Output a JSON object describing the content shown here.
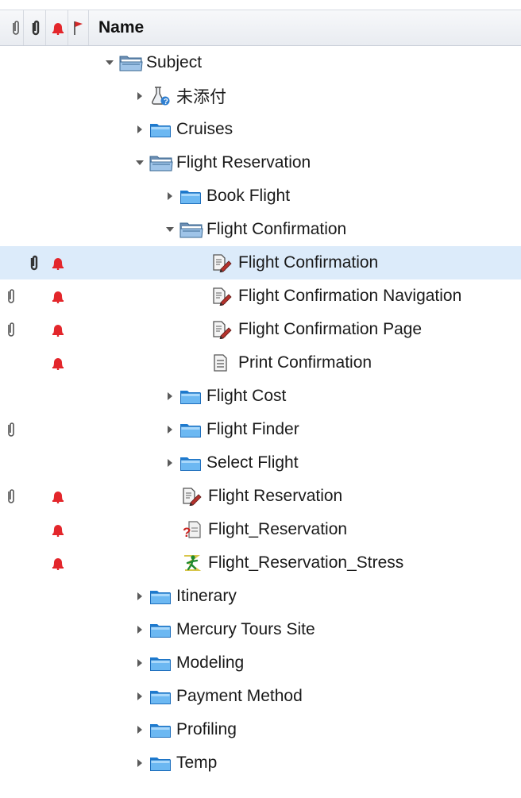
{
  "header": {
    "name_label": "Name",
    "columns": [
      {
        "icon": "attachment-icon"
      },
      {
        "icon": "attachment-icon"
      },
      {
        "icon": "alert-bell-icon"
      },
      {
        "icon": "flag-icon"
      }
    ]
  },
  "colors": {
    "header_bg": "#eceef2",
    "selection": "#dcebfa",
    "folder": "#2b8fe0",
    "bell": "#e3262b",
    "flag": "#d42828"
  },
  "tree": [
    {
      "label": "Subject",
      "icon": "folder-open-icon",
      "toggle": "expanded",
      "level": 0,
      "attachment": "",
      "alert": false
    },
    {
      "label": "未添付",
      "icon": "unattached-test-icon",
      "toggle": "collapsed",
      "level": 1,
      "attachment": "",
      "alert": false
    },
    {
      "label": "Cruises",
      "icon": "folder-icon",
      "toggle": "collapsed",
      "level": 1,
      "attachment": "",
      "alert": false
    },
    {
      "label": "Flight Reservation",
      "icon": "folder-open-icon",
      "toggle": "expanded",
      "level": 1,
      "attachment": "",
      "alert": false
    },
    {
      "label": "Book Flight",
      "icon": "folder-icon",
      "toggle": "collapsed",
      "level": 2,
      "attachment": "",
      "alert": false
    },
    {
      "label": "Flight Confirmation",
      "icon": "folder-open-icon",
      "toggle": "expanded",
      "level": 2,
      "attachment": "",
      "alert": false
    },
    {
      "label": "Flight Confirmation",
      "icon": "manual-test-icon",
      "toggle": "none",
      "level": 3,
      "attachment": "bold",
      "alert": true,
      "selected": true
    },
    {
      "label": "Flight Confirmation Navigation",
      "icon": "manual-test-icon",
      "toggle": "none",
      "level": 3,
      "attachment": "normal",
      "alert": true
    },
    {
      "label": "Flight Confirmation Page",
      "icon": "manual-test-icon",
      "toggle": "none",
      "level": 3,
      "attachment": "normal",
      "alert": true
    },
    {
      "label": "Print Confirmation",
      "icon": "document-test-icon",
      "toggle": "none",
      "level": 3,
      "attachment": "",
      "alert": true
    },
    {
      "label": "Flight Cost",
      "icon": "folder-icon",
      "toggle": "collapsed",
      "level": 2,
      "attachment": "",
      "alert": false
    },
    {
      "label": "Flight Finder",
      "icon": "folder-icon",
      "toggle": "collapsed",
      "level": 2,
      "attachment": "normal",
      "alert": false
    },
    {
      "label": "Select Flight",
      "icon": "folder-icon",
      "toggle": "collapsed",
      "level": 2,
      "attachment": "",
      "alert": false
    },
    {
      "label": "Flight Reservation",
      "icon": "manual-test-icon",
      "toggle": "none",
      "level": 2,
      "attachment": "normal",
      "alert": true
    },
    {
      "label": "Flight_Reservation",
      "icon": "unknown-test-icon",
      "toggle": "none",
      "level": 2,
      "attachment": "",
      "alert": true
    },
    {
      "label": "Flight_Reservation_Stress",
      "icon": "stress-test-icon",
      "toggle": "none",
      "level": 2,
      "attachment": "",
      "alert": true
    },
    {
      "label": "Itinerary",
      "icon": "folder-icon",
      "toggle": "collapsed",
      "level": 1,
      "attachment": "",
      "alert": false
    },
    {
      "label": "Mercury Tours Site",
      "icon": "folder-icon",
      "toggle": "collapsed",
      "level": 1,
      "attachment": "",
      "alert": false
    },
    {
      "label": "Modeling",
      "icon": "folder-icon",
      "toggle": "collapsed",
      "level": 1,
      "attachment": "",
      "alert": false
    },
    {
      "label": "Payment Method",
      "icon": "folder-icon",
      "toggle": "collapsed",
      "level": 1,
      "attachment": "",
      "alert": false
    },
    {
      "label": "Profiling",
      "icon": "folder-icon",
      "toggle": "collapsed",
      "level": 1,
      "attachment": "",
      "alert": false
    },
    {
      "label": "Temp",
      "icon": "folder-icon",
      "toggle": "collapsed",
      "level": 1,
      "attachment": "",
      "alert": false
    }
  ]
}
